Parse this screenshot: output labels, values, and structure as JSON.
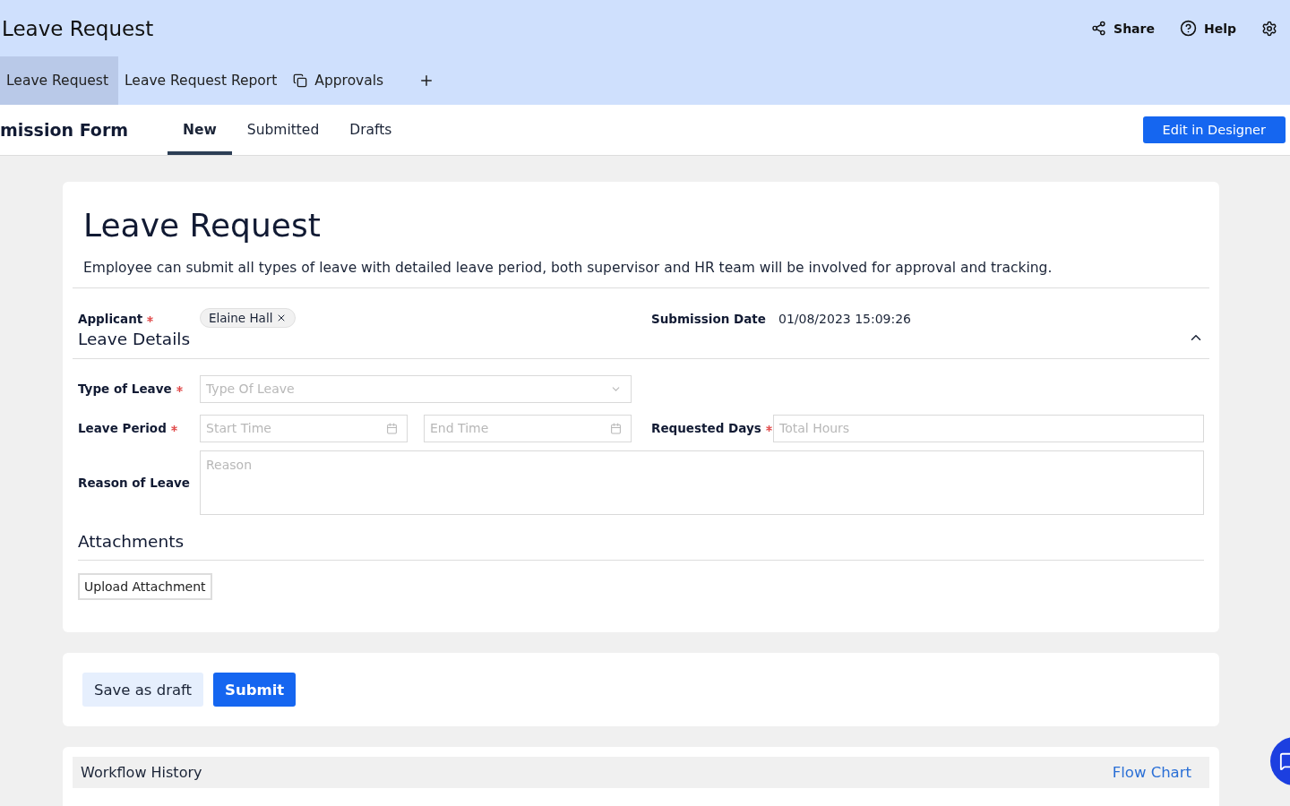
{
  "app": {
    "title": "Leave Request",
    "actions": [
      {
        "kind": "share",
        "label": "Share"
      },
      {
        "kind": "help",
        "label": "Help"
      },
      {
        "kind": "settings"
      }
    ]
  },
  "app_tabs": [
    {
      "label": "Leave Request",
      "selected": true,
      "kind": "plain"
    },
    {
      "label": "Leave Request Report",
      "selected": false,
      "kind": "plain"
    },
    {
      "label": "Approvals",
      "selected": false,
      "kind": "with_icon"
    }
  ],
  "form_bar": {
    "title": "mission Form",
    "tabs": [
      {
        "label": "New",
        "selected": true
      },
      {
        "label": "Submitted",
        "selected": false
      },
      {
        "label": "Drafts",
        "selected": false
      }
    ],
    "button": "Edit in Designer"
  },
  "form": {
    "title": "Leave Request",
    "description": "Employee can submit all types of leave with detailed leave period, both supervisor and HR team will be involved for approval and tracking.",
    "applicant": {
      "label": "Applicant",
      "required": true,
      "value": "Elaine Hall"
    },
    "submission_date": {
      "label": "Submission Date",
      "value": "01/08/2023 15:09:26"
    },
    "section": {
      "title": "Leave Details",
      "expanded": true
    },
    "type_of_leave": {
      "label": "Type of Leave",
      "required": true,
      "placeholder": "Type Of Leave"
    },
    "leave_period": {
      "label": "Leave Period",
      "required": true,
      "start_placeholder": "Start Time",
      "end_placeholder": "End Time"
    },
    "requested_days": {
      "label": "Requested Days",
      "required": true,
      "placeholder": "Total Hours"
    },
    "reason": {
      "label": "Reason of Leave",
      "required": false,
      "placeholder": "Reason"
    },
    "attachments": {
      "title": "Attachments",
      "button": "Upload Attachment"
    }
  },
  "actions": [
    {
      "label": "Save as draft",
      "kind": "secondary"
    },
    {
      "label": "Submit",
      "kind": "primary"
    }
  ],
  "workflow": {
    "title": "Workflow History",
    "link": "Flow Chart"
  }
}
